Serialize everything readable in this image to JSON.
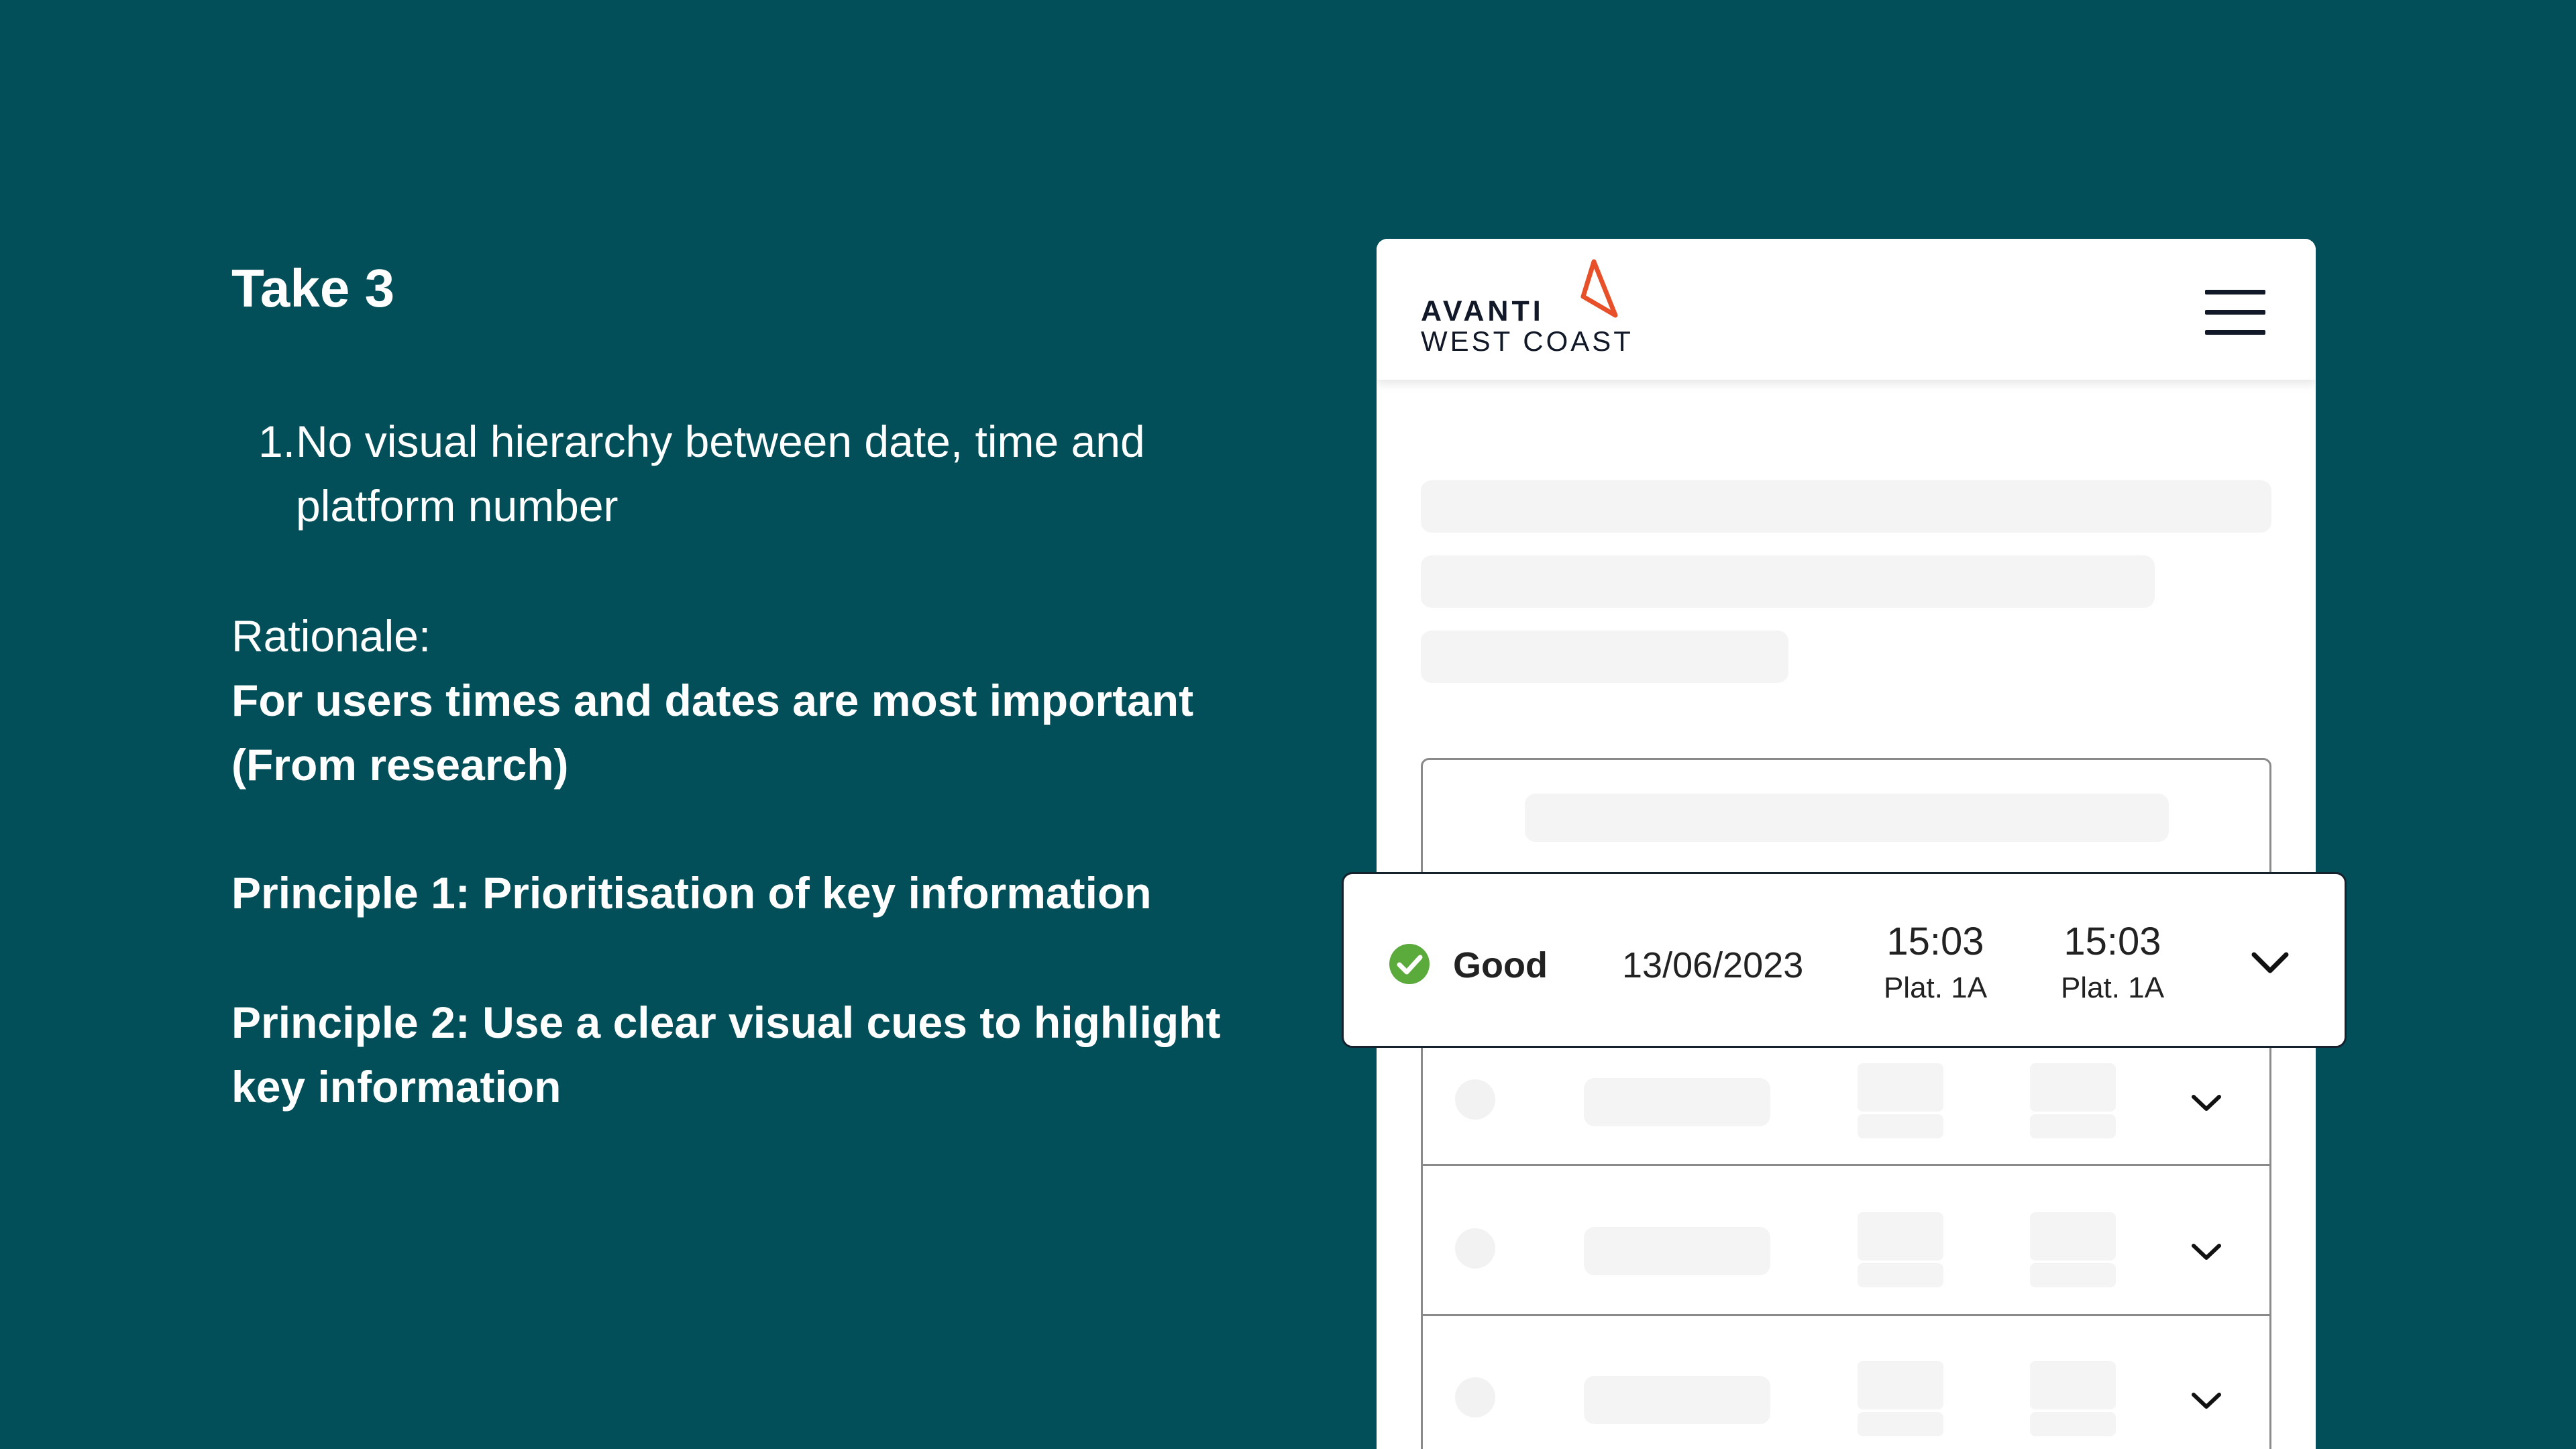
{
  "slide": {
    "title": "Take 3",
    "issues": [
      {
        "number": "1.",
        "text": "No visual hierarchy between date, time and platform number"
      }
    ],
    "rationale_label": "Rationale:",
    "rationale_text": "For users times and dates are most important (From research)",
    "principles": [
      "Principle 1: Prioritisation of key information",
      "Principle 2: Use a clear visual cues to highlight key information"
    ]
  },
  "phone": {
    "brand": {
      "line1": "AVANTI",
      "line2": "WEST COAST",
      "accent_color": "#e8502a"
    },
    "menu_icon": "hamburger-icon"
  },
  "journey": {
    "status": "Good",
    "status_icon": "check-circle-icon",
    "status_color": "#5aaa3c",
    "date": "13/06/2023",
    "departure_time": "15:03",
    "departure_platform": "Plat. 1A",
    "arrival_time": "15:03",
    "arrival_platform": "Plat. 1A",
    "expand_icon": "chevron-down-icon"
  },
  "colors": {
    "background": "#024f5a",
    "text_on_background": "#ffffff",
    "skeleton": "#f4f4f4"
  }
}
